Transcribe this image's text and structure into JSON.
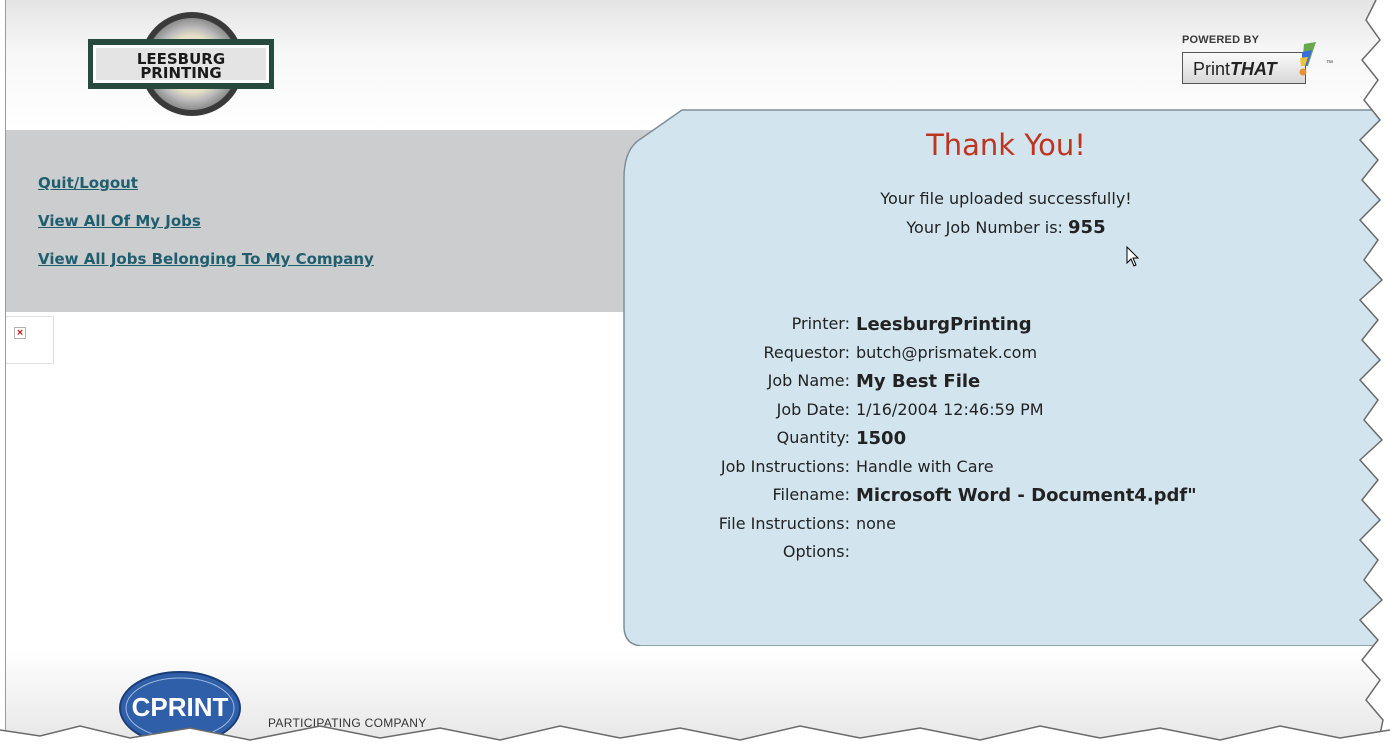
{
  "header": {
    "logo_text_line1": "LEESBURG",
    "logo_text_line2": "PRINTING",
    "powered_by_label": "POWERED BY",
    "powered_brand_plain": "Print",
    "powered_brand_bold": "THAT",
    "powered_brand_mark": "™"
  },
  "nav": {
    "items": [
      {
        "label": "Quit/Logout"
      },
      {
        "label": "View All Of My Jobs"
      },
      {
        "label": "View All Jobs Belonging To My Company"
      }
    ]
  },
  "confirmation": {
    "title": "Thank You!",
    "message": "Your file uploaded successfully!",
    "job_number_label": "Your Job Number is:",
    "job_number": "955"
  },
  "details": [
    {
      "label": "Printer:",
      "value": "LeesburgPrinting",
      "bold": true
    },
    {
      "label": "Requestor:",
      "value": "butch@prismatek.com",
      "bold": false
    },
    {
      "label": "Job Name:",
      "value": "My Best File",
      "bold": true
    },
    {
      "label": "Job Date:",
      "value": "1/16/2004 12:46:59 PM",
      "bold": false
    },
    {
      "label": "Quantity:",
      "value": "1500",
      "bold": true
    },
    {
      "label": "Job Instructions:",
      "value": "Handle with Care",
      "bold": false
    },
    {
      "label": "Filename:",
      "value": "Microsoft Word - Document4.pdf\"",
      "bold": true
    },
    {
      "label": "File Instructions:",
      "value": "none",
      "bold": false
    },
    {
      "label": "Options:",
      "value": "",
      "bold": false
    }
  ],
  "footer": {
    "badge_text": "CPRINT",
    "participating_label": "PARTICIPATING COMPANY"
  },
  "colors": {
    "panel_bg": "#d2e5ef",
    "nav_bg": "#cccdcf",
    "link": "#1f5e6e",
    "title": "#c0341d",
    "cprint_blue": "#2f5fa8"
  }
}
